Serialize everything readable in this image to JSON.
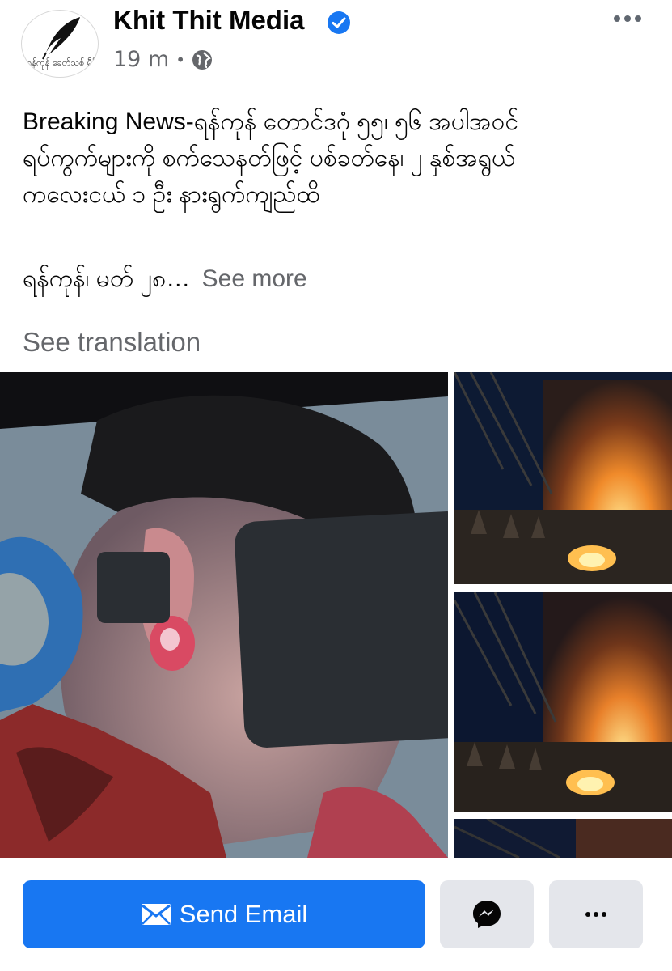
{
  "post": {
    "page_name": "Khit Thit Media",
    "avatar_text": "ရန်ကုန် ခေတ်သစ် မီဒီယာ",
    "time": "19 m",
    "text_lines": [
      "Breaking News-ရန်ကုန် တောင်ဒဂုံ ၅၅၊ ၅၆ အပါအဝင်",
      "ရပ်ကွက်များကို စက်သေနတ်ဖြင့် ပစ်ခတ်နေ၊ ၂ နှစ်အရွယ်",
      "ကလေးငယ် ၁ ဦး နားရွက်ကျည်ထိ"
    ],
    "snippet": "ရန်ကုန်၊ မတ် ၂၈…",
    "see_more": "See more",
    "see_translation": "See translation"
  },
  "icons": {
    "verified": "verified-badge-icon",
    "globe": "globe-icon",
    "more": "more-options-icon",
    "email": "envelope-icon",
    "messenger": "messenger-icon"
  },
  "actions": {
    "send_email": "Send Email"
  },
  "colors": {
    "brand_blue": "#1877f2",
    "secondary_text": "#65676b",
    "button_gray": "#e4e6eb"
  }
}
